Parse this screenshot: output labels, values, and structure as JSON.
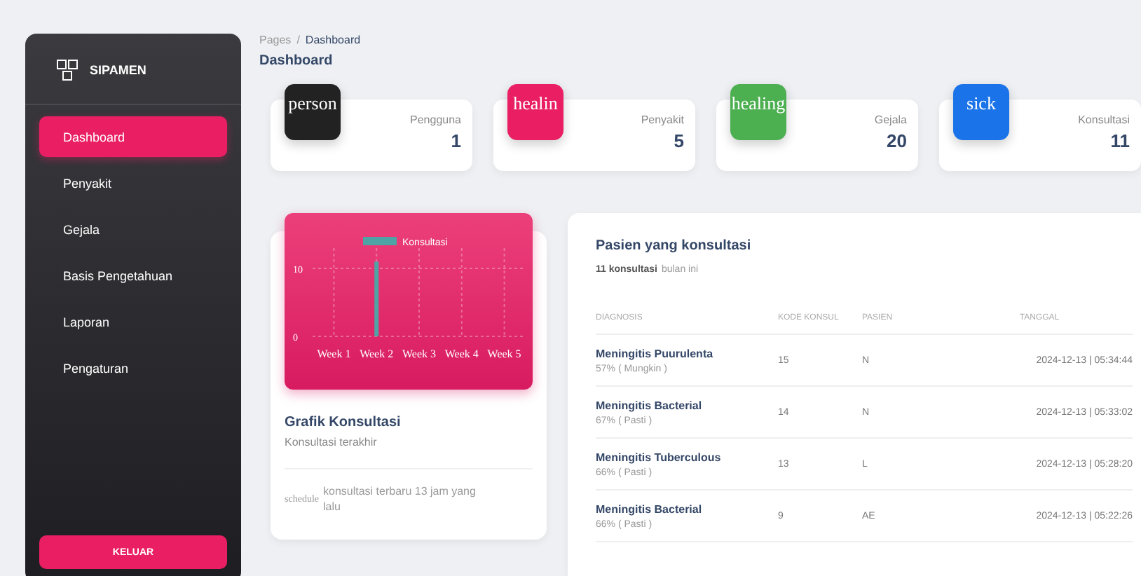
{
  "sidebar": {
    "brand": "SIPAMEN",
    "items": [
      {
        "label": "Dashboard",
        "selected": true
      },
      {
        "label": "Penyakit",
        "selected": false
      },
      {
        "label": "Gejala",
        "selected": false
      },
      {
        "label": "Basis Pengetahuan",
        "selected": false
      },
      {
        "label": "Laporan",
        "selected": false
      },
      {
        "label": "Pengaturan",
        "selected": false
      }
    ],
    "logout": "KELUAR"
  },
  "header": {
    "breadcrumb": [
      "Pages",
      "Dashboard"
    ],
    "separator": "/",
    "title": "Dashboard"
  },
  "stats": [
    {
      "icon_text": "person",
      "color": "#222222",
      "label": "Pengguna",
      "value": "1"
    },
    {
      "icon_text": "healin",
      "color": "#e91e63",
      "label": "Penyakit",
      "value": "5"
    },
    {
      "icon_text": "healing",
      "color": "#4caf50",
      "label": "Gejala",
      "value": "20"
    },
    {
      "icon_text": "sick",
      "color": "#1a73e8",
      "label": "Konsultasi",
      "value": "11"
    }
  ],
  "chart_card": {
    "chart_data": {
      "type": "bar",
      "categories": [
        "Week 1",
        "Week 2",
        "Week 3",
        "Week 4",
        "Week 5"
      ],
      "series": [
        {
          "name": "Konsultasi",
          "color": "#4fa3a5",
          "values": [
            null,
            11,
            null,
            null,
            null
          ]
        }
      ],
      "yticks": [
        0,
        10
      ],
      "ylim": [
        0,
        13
      ],
      "grid": true
    },
    "title": "Grafik Konsultasi",
    "subtitle": "Konsultasi terakhir",
    "footer_icon_text": "schedule",
    "footer": "konsultasi terbaru 13 jam yang lalu"
  },
  "table": {
    "title": "Pasien yang konsultasi",
    "count": "11 konsultasi",
    "count_suffix": "bulan ini",
    "columns": [
      "DIAGNOSIS",
      "KODE KONSUL",
      "PASIEN",
      "TANGGAL"
    ],
    "rows": [
      {
        "diagnosis": "Meningitis Puurulenta",
        "certainty": "57% ( Mungkin )",
        "code": "15",
        "patient": "N",
        "date": "2024-12-13 | 05:34:44"
      },
      {
        "diagnosis": "Meningitis Bacterial",
        "certainty": "67% ( Pasti )",
        "code": "14",
        "patient": "N",
        "date": "2024-12-13 | 05:33:02"
      },
      {
        "diagnosis": "Meningitis Tuberculous",
        "certainty": "66% ( Pasti )",
        "code": "13",
        "patient": "L",
        "date": "2024-12-13 | 05:28:20"
      },
      {
        "diagnosis": "Meningitis Bacterial",
        "certainty": "66% ( Pasti )",
        "code": "9",
        "patient": "AE",
        "date": "2024-12-13 | 05:22:26"
      }
    ]
  }
}
